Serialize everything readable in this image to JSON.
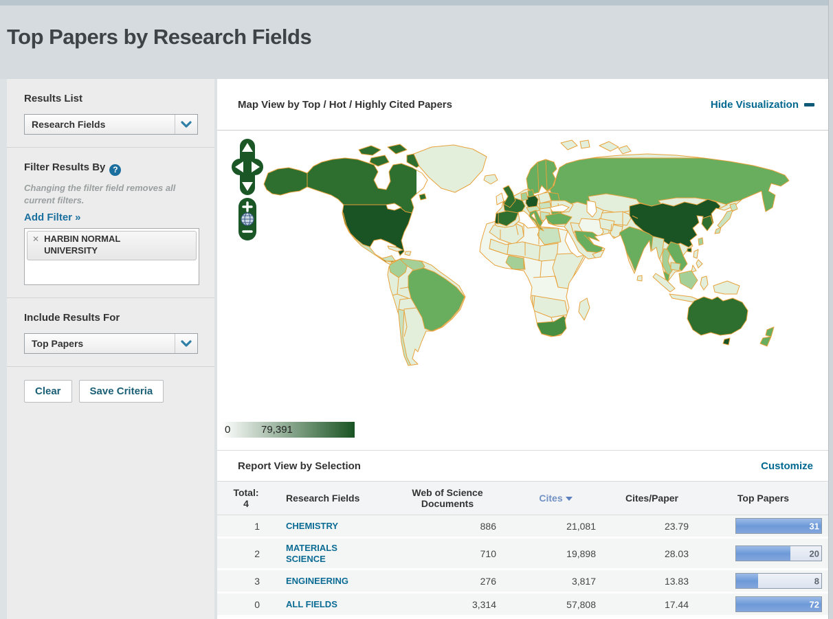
{
  "page": {
    "title": "Top Papers by Research Fields"
  },
  "sidebar": {
    "results_list": {
      "label": "Results List",
      "selected": "Research Fields"
    },
    "filter": {
      "label": "Filter Results By",
      "note": "Changing the filter field removes all current filters.",
      "add_filter": "Add Filter »",
      "tag": {
        "text": "HARBIN NORMAL UNIVERSITY",
        "remove_symbol": "✕"
      }
    },
    "include": {
      "label": "Include Results For",
      "selected": "Top Papers"
    },
    "buttons": {
      "clear": "Clear",
      "save": "Save Criteria"
    }
  },
  "viz": {
    "title": "Map View by Top / Hot / Highly Cited Papers",
    "hide": "Hide Visualization"
  },
  "map": {
    "legend": {
      "min": "0",
      "max": "79,391"
    },
    "palette": {
      "0": "#f2f7ee",
      "1": "#e3efdb",
      "2": "#c9e2bf",
      "3": "#a4cf97",
      "4": "#69ad5e",
      "4.5": "#478e42",
      "5": "#2e6f2f",
      "6": "#1b5424"
    },
    "border_color": "#e8a23b",
    "countries": [
      {
        "id": "north-america-base",
        "level": "5"
      },
      {
        "id": "usa",
        "level": "6"
      },
      {
        "id": "mexico",
        "level": "2"
      },
      {
        "id": "central-america",
        "level": "1"
      },
      {
        "id": "greenland",
        "level": "1"
      },
      {
        "id": "iceland",
        "level": "1"
      },
      {
        "id": "cuba",
        "level": "1"
      },
      {
        "id": "hispaniola",
        "level": "1"
      },
      {
        "id": "south-america-base",
        "level": "1"
      },
      {
        "id": "colombia",
        "level": "3"
      },
      {
        "id": "venezuela",
        "level": "3"
      },
      {
        "id": "brazil",
        "level": "4"
      },
      {
        "id": "chile",
        "level": "2"
      },
      {
        "id": "uk",
        "level": "5"
      },
      {
        "id": "ireland",
        "level": "0"
      },
      {
        "id": "scandinavia",
        "level": "4"
      },
      {
        "id": "denmark",
        "level": "4"
      },
      {
        "id": "eurasia-base",
        "level": "1"
      },
      {
        "id": "russia",
        "level": "4"
      },
      {
        "id": "kazakhstan",
        "level": "1"
      },
      {
        "id": "central-asia",
        "level": "1"
      },
      {
        "id": "mongolia",
        "level": "1"
      },
      {
        "id": "china",
        "level": "6"
      },
      {
        "id": "france",
        "level": "5"
      },
      {
        "id": "spain",
        "level": "5"
      },
      {
        "id": "portugal",
        "level": "6"
      },
      {
        "id": "germany",
        "level": "6"
      },
      {
        "id": "benelux",
        "level": "3"
      },
      {
        "id": "alpine",
        "level": "2"
      },
      {
        "id": "italy",
        "level": "4"
      },
      {
        "id": "poland",
        "level": "1"
      },
      {
        "id": "czech",
        "level": "2"
      },
      {
        "id": "ukraine",
        "level": "1"
      },
      {
        "id": "belarus",
        "level": "4"
      },
      {
        "id": "romania",
        "level": "4"
      },
      {
        "id": "balkans",
        "level": "2"
      },
      {
        "id": "greece",
        "level": "4"
      },
      {
        "id": "turkey",
        "level": "4"
      },
      {
        "id": "iraq",
        "level": "1"
      },
      {
        "id": "iran",
        "level": "0"
      },
      {
        "id": "saudi",
        "level": "4"
      },
      {
        "id": "yemen-oman",
        "level": "1"
      },
      {
        "id": "pakistan",
        "level": "1"
      },
      {
        "id": "afghanistan",
        "level": "1"
      },
      {
        "id": "india",
        "level": "4"
      },
      {
        "id": "myanmar",
        "level": "2"
      },
      {
        "id": "thailand",
        "level": "3"
      },
      {
        "id": "vietnam",
        "level": "4"
      },
      {
        "id": "cambodia",
        "level": "2"
      },
      {
        "id": "malaysia",
        "level": "4"
      },
      {
        "id": "south-korea",
        "level": "5"
      },
      {
        "id": "africa-base",
        "level": "0"
      },
      {
        "id": "algeria",
        "level": "1"
      },
      {
        "id": "sahel",
        "level": "1"
      },
      {
        "id": "egypt",
        "level": "2"
      },
      {
        "id": "nigeria",
        "level": "3"
      },
      {
        "id": "east-africa",
        "level": "1"
      },
      {
        "id": "southern-africa",
        "level": "1"
      },
      {
        "id": "south-africa",
        "level": "4.5"
      },
      {
        "id": "madagascar",
        "level": "1"
      },
      {
        "id": "japan",
        "level": "2"
      },
      {
        "id": "taiwan",
        "level": "3"
      },
      {
        "id": "hainan",
        "level": "6"
      },
      {
        "id": "sri-lanka",
        "level": "1"
      },
      {
        "id": "philippines",
        "level": "1"
      },
      {
        "id": "sumatra",
        "level": "1"
      },
      {
        "id": "borneo",
        "level": "3"
      },
      {
        "id": "java",
        "level": "1"
      },
      {
        "id": "sulawesi",
        "level": "1"
      },
      {
        "id": "new-guinea",
        "level": "1"
      },
      {
        "id": "australia",
        "level": "5"
      },
      {
        "id": "tasmania",
        "level": "6"
      },
      {
        "id": "new-zealand",
        "level": "4"
      },
      {
        "id": "svalbard",
        "level": "1"
      },
      {
        "id": "novaya-zemlya",
        "level": "1"
      }
    ],
    "controls": [
      "pan-up",
      "pan-down",
      "pan-left",
      "pan-right",
      "zoom-in",
      "globe",
      "zoom-out"
    ]
  },
  "report": {
    "title": "Report View by Selection",
    "customize": "Customize"
  },
  "report_table": {
    "headers": {
      "total": "Total:",
      "total_count": "4",
      "field": "Research Fields",
      "wos": "Web of Science Documents",
      "cites": "Cites",
      "cites_paper": "Cites/Paper",
      "top": "Top Papers"
    },
    "bar_label_colors": {
      "on_fill": "#ffffff",
      "on_track": "#5d6670"
    },
    "rows": [
      {
        "rank": "1",
        "field": "CHEMISTRY",
        "wos": "886",
        "cites": "21,081",
        "cpp": "23.79",
        "top": "31",
        "bar_pct": 100
      },
      {
        "rank": "2",
        "field": "MATERIALS SCIENCE",
        "wos": "710",
        "cites": "19,898",
        "cpp": "28.03",
        "top": "20",
        "bar_pct": 64
      },
      {
        "rank": "3",
        "field": "ENGINEERING",
        "wos": "276",
        "cites": "3,817",
        "cpp": "13.83",
        "top": "8",
        "bar_pct": 26
      },
      {
        "rank": "0",
        "field": "ALL FIELDS",
        "wos": "3,314",
        "cites": "57,808",
        "cpp": "17.44",
        "top": "72",
        "bar_pct": 100
      }
    ]
  }
}
